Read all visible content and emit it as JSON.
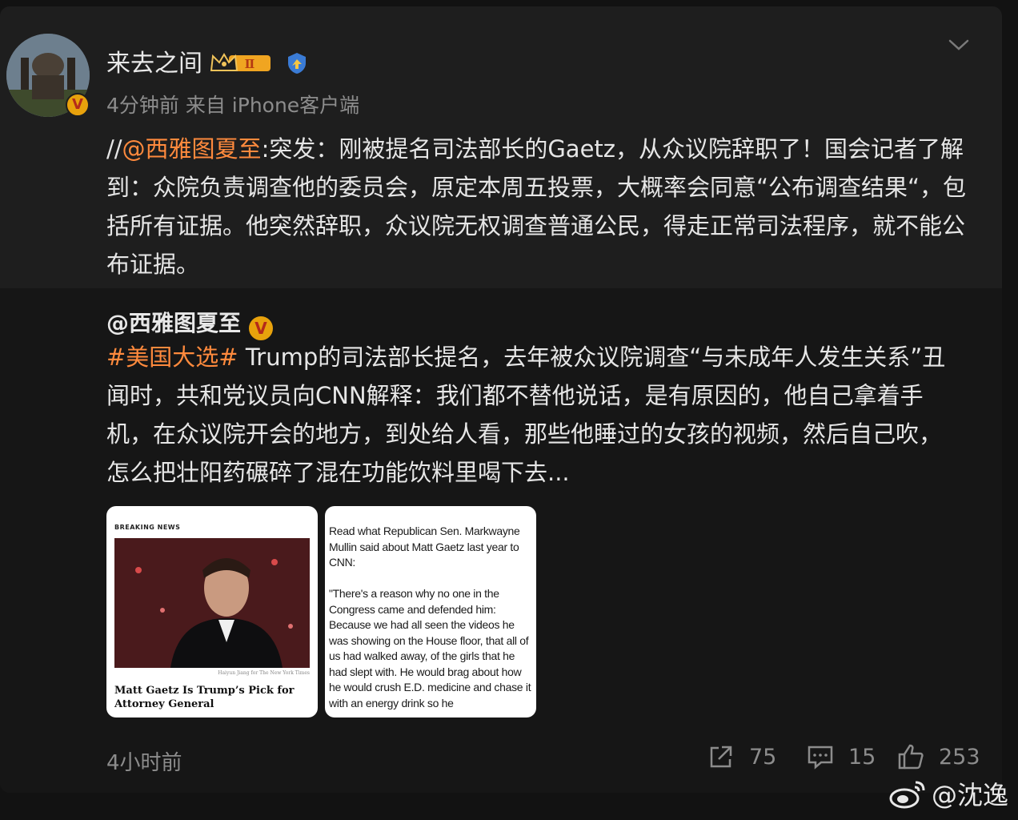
{
  "post": {
    "username": "来去之间",
    "level_badge": "Ⅱ",
    "meta": "4分钟前  来自 iPhone客户端",
    "prefix": "//",
    "mention": "@西雅图夏至",
    "text": ":突发：刚被提名司法部长的Gaetz，从众议院辞职了！国会记者了解到：众院负责调查他的委员会，原定本周五投票，大概率会同意“公布调查结果“，包括所有证据。他突然辞职，众议院无权调查普通公民，得走正常司法程序，就不能公布证据。"
  },
  "repost": {
    "username": "@西雅图夏至",
    "hashtag": "#美国大选#",
    "text": " Trump的司法部长提名，去年被众议院调查“与未成年人发生关系”丑闻时，共和党议员向CNN解释：我们都不替他说话，是有原因的，他自己拿着手机，在众议院开会的地方，到处给人看，那些他睡过的女孩的视频，然后自己吹，怎么把壮阳药碾碎了混在功能饮料里喝下去...",
    "image1": {
      "label": "BREAKING NEWS",
      "credit": "Haiyun Jiang for The New York Times",
      "headline": "Matt Gaetz Is Trump’s Pick for Attorney General"
    },
    "image2": {
      "text": "Read what Republican Sen. Markwayne Mullin said about Matt Gaetz last year to CNN:\n\n\"There's a reason why no one in the Congress came and defended him: Because we had all seen the videos he was showing on the House floor, that all of us had walked away, of the girls that he had slept with. He would brag about how he would crush E.D. medicine and chase it with an energy drink so he"
    },
    "time": "4小时前",
    "reposts": "75",
    "comments": "15",
    "likes": "253"
  },
  "watermark": "@沈逸",
  "colors": {
    "link": "#ff8a3d",
    "badge": "#e8a20c",
    "verify": "#3a7bd5"
  }
}
